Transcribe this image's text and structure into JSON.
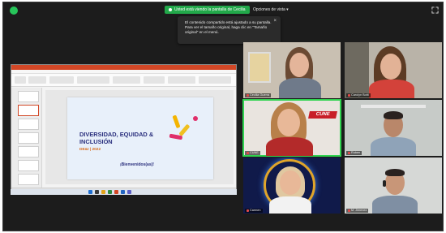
{
  "top_bar": {
    "share_label": "Usted está viendo la pantalla de Cecilia",
    "view_options_label": "Opciones de vista"
  },
  "tooltip": {
    "message": "El contenido compartido está ajustado a su pantalla. Para ver el tamaño original, haga clic en \"Tamaño original\" en el menú.",
    "close": "×"
  },
  "shared_screen": {
    "slide": {
      "title": "DIVERSIDAD, EQUIDAD & INCLUSIÓN",
      "subtitle": "DE&I | 2022",
      "welcome": "¡Bienvenidos(as)!"
    }
  },
  "participants": [
    {
      "name": "Cecilia Guerra"
    },
    {
      "name": "Carolyn Botti"
    },
    {
      "name": "CUNE"
    },
    {
      "name": "Ruben"
    },
    {
      "name": "Carmen"
    },
    {
      "name": "M. Jimenez"
    }
  ],
  "colors": {
    "share_green": "#22a84a",
    "active_speaker": "#2fd34f",
    "slide_title": "#2a2f7d",
    "ppt_accent": "#d24726",
    "cune_red": "#c81e28"
  },
  "icons": [
    "shield-icon",
    "fullscreen-icon",
    "close-icon",
    "mic-muted-icon"
  ]
}
